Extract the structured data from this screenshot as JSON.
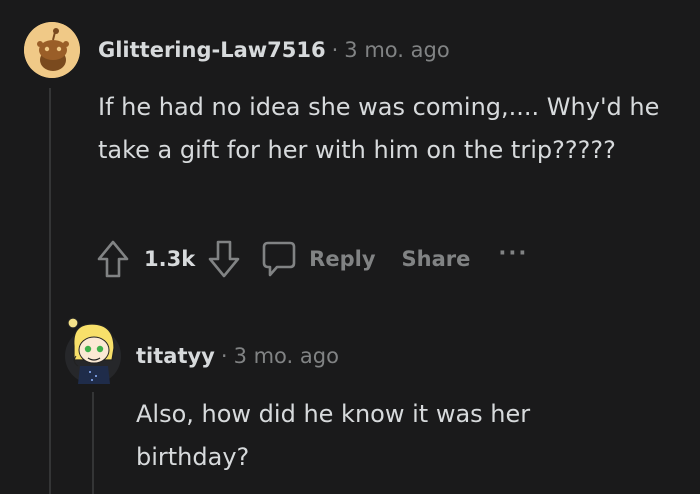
{
  "comments": [
    {
      "username": "Glittering-Law7516",
      "separator": "·",
      "time": "3 mo. ago",
      "body": "If he had no idea she was coming,.... Why'd he take a gift for her with him on the trip?????",
      "votes": "1.3k",
      "reply_label": "Reply",
      "share_label": "Share",
      "more_label": "···"
    },
    {
      "username": "titatyy",
      "separator": "·",
      "time": "3 mo. ago",
      "body": "Also, how did he know it was her birthday?"
    }
  ],
  "colors": {
    "background": "#1a1a1b",
    "text": "#d7dadc",
    "muted": "#818384",
    "thread_line": "#343536",
    "snoo_avatar_bg": "#f0c987"
  }
}
